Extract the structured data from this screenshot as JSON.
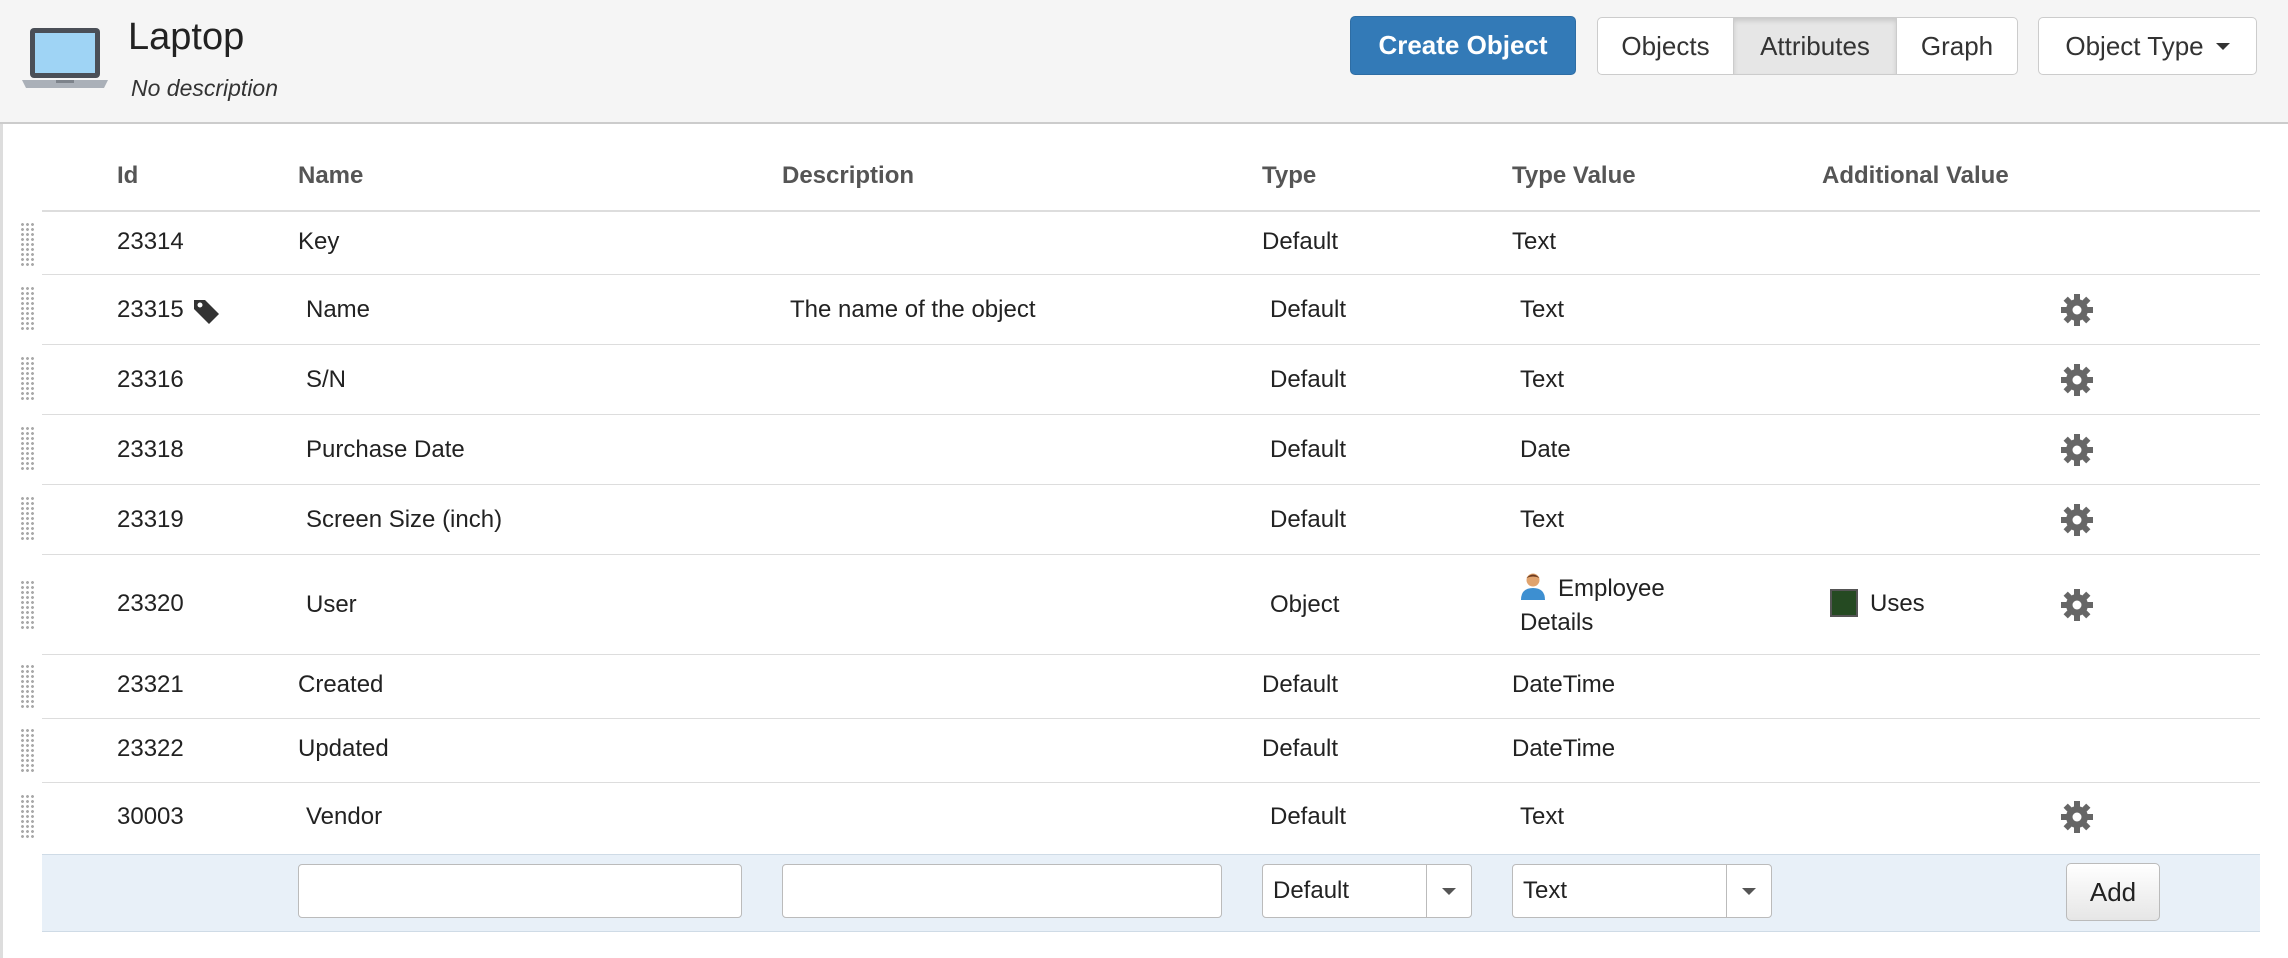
{
  "header": {
    "icon": "laptop-icon",
    "title": "Laptop",
    "subtitle": "No description",
    "create_button": "Create Object",
    "view_tabs": [
      "Objects",
      "Attributes",
      "Graph"
    ],
    "active_tab": "Attributes",
    "object_type_dropdown": "Object Type",
    "accent_color": "#337ab7"
  },
  "table": {
    "columns": [
      "Id",
      "Name",
      "Description",
      "Type",
      "Type Value",
      "Additional Value"
    ],
    "rows": [
      {
        "id": "23314",
        "name": "Key",
        "description": "",
        "type": "Default",
        "type_value": "Text",
        "additional": "",
        "label_icon": false,
        "settings": false
      },
      {
        "id": "23315",
        "name": "Name",
        "description": "The name of the object",
        "type": "Default",
        "type_value": "Text",
        "additional": "",
        "label_icon": true,
        "settings": true
      },
      {
        "id": "23316",
        "name": "S/N",
        "description": "",
        "type": "Default",
        "type_value": "Text",
        "additional": "",
        "label_icon": false,
        "settings": true
      },
      {
        "id": "23318",
        "name": "Purchase Date",
        "description": "",
        "type": "Default",
        "type_value": "Date",
        "additional": "",
        "label_icon": false,
        "settings": true
      },
      {
        "id": "23319",
        "name": "Screen Size (inch)",
        "description": "",
        "type": "Default",
        "type_value": "Text",
        "additional": "",
        "label_icon": false,
        "settings": true
      },
      {
        "id": "23320",
        "name": "User",
        "description": "",
        "type": "Object",
        "type_value_line1": "Employee",
        "type_value_line2": "Details",
        "type_value_icon": "person-icon",
        "additional": "Uses",
        "additional_color": "#254a22",
        "label_icon": false,
        "settings": true
      },
      {
        "id": "23321",
        "name": "Created",
        "description": "",
        "type": "Default",
        "type_value": "DateTime",
        "additional": "",
        "label_icon": false,
        "settings": false
      },
      {
        "id": "23322",
        "name": "Updated",
        "description": "",
        "type": "Default",
        "type_value": "DateTime",
        "additional": "",
        "label_icon": false,
        "settings": false
      },
      {
        "id": "30003",
        "name": "Vendor",
        "description": "",
        "type": "Default",
        "type_value": "Text",
        "additional": "",
        "label_icon": false,
        "settings": true
      }
    ]
  },
  "add_row": {
    "name_value": "",
    "description_value": "",
    "type_select": "Default",
    "type_value_select": "Text",
    "add_button": "Add"
  }
}
